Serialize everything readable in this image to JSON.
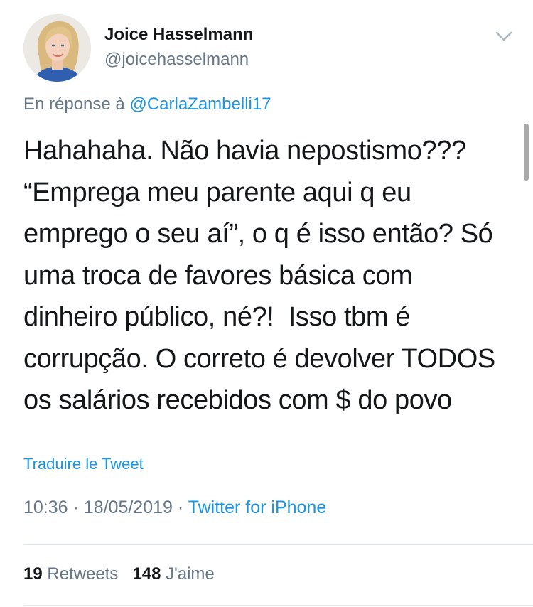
{
  "author": {
    "name": "Joice Hasselmann",
    "handle": "@joicehasselmann"
  },
  "reply_context": {
    "prefix": "En réponse à",
    "mention": "@CarlaZambelli17"
  },
  "tweet": {
    "text": "Hahahaha. Não havia nepostismo???\n“Emprega meu parente aqui q eu\nemprego o seu aí”, o q é isso então? Só\numa troca de favores básica com\ndinheiro público, né?!  Isso tbm é\ncorrupção. O correto é devolver TODOS\nos salários recebidos com $ do povo"
  },
  "translate_label": "Traduire le Tweet",
  "meta": {
    "time": "10:36",
    "date": "18/05/2019",
    "separator": "·",
    "source": "Twitter for iPhone"
  },
  "stats": {
    "retweets_count": "19",
    "retweets_label": "Retweets",
    "likes_count": "148",
    "likes_label": "J'aime"
  },
  "icons": {
    "caret": "chevron-down-icon",
    "avatar": "profile-photo"
  },
  "colors": {
    "link": "#1b95e0",
    "secondary_text": "#657786",
    "primary_text": "#14171a",
    "divider": "#e1e8ed"
  }
}
